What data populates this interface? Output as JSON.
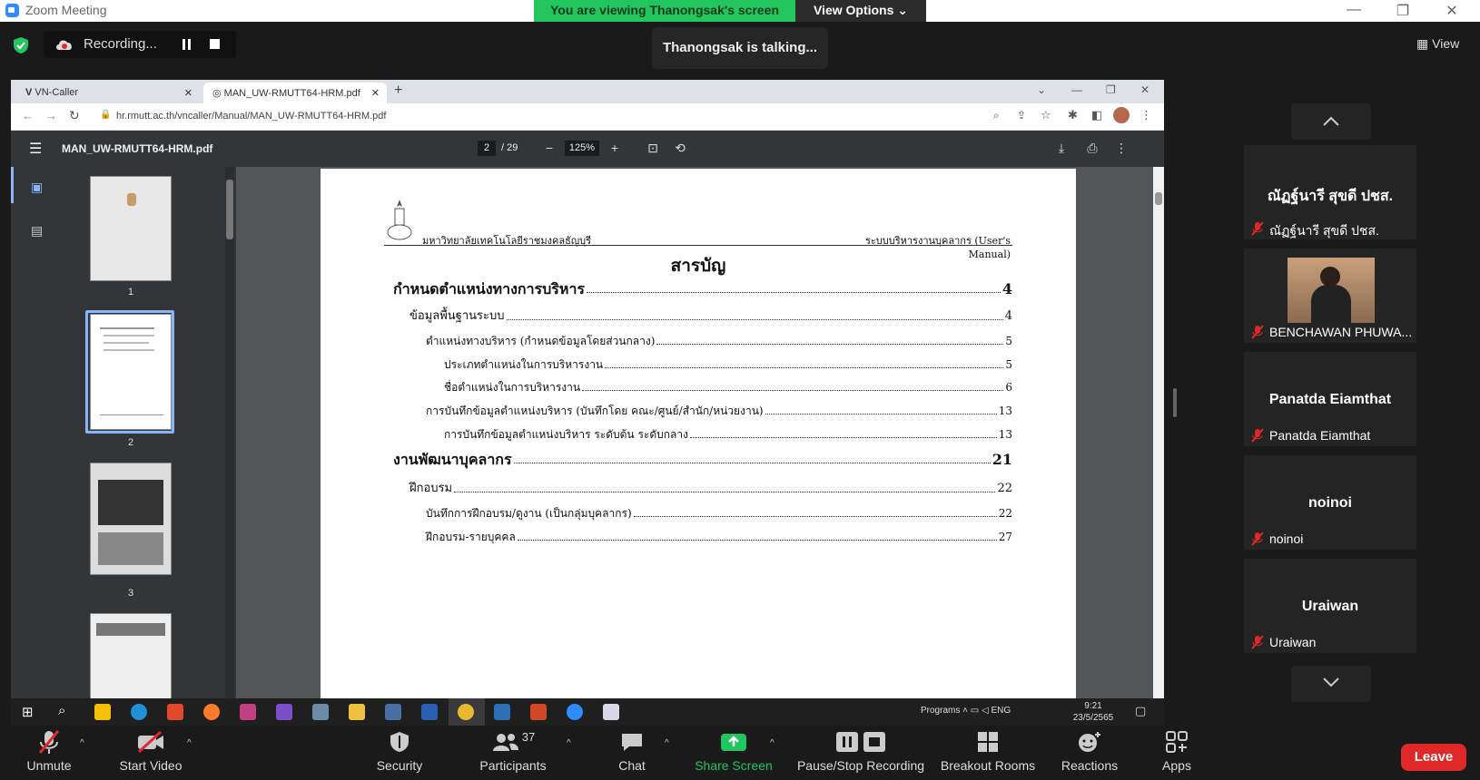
{
  "window": {
    "title": "Zoom Meeting"
  },
  "banner": {
    "viewing": "You are viewing Thanongsak's screen",
    "view_options": "View Options"
  },
  "meeting": {
    "recording": "Recording...",
    "talking": "Thanongsak is talking...",
    "view_label": "View"
  },
  "browser": {
    "tabs": [
      {
        "label": "VN-Caller"
      },
      {
        "label": "MAN_UW-RMUTT64-HRM.pdf"
      }
    ],
    "url": "hr.rmutt.ac.th/vncaller/Manual/MAN_UW-RMUTT64-HRM.pdf"
  },
  "pdf": {
    "filename": "MAN_UW-RMUTT64-HRM.pdf",
    "page_current": "2",
    "page_total": "/ 29",
    "zoom": "125%",
    "thumb_numbers": [
      "1",
      "2",
      "3"
    ],
    "header_left": "มหาวิทยาลัยเทคโนโลยีราชมงคลธัญบุรี",
    "header_right": "ระบบบริหารงานบุคลากร (User's Manual)",
    "toc_title": "สารบัญ",
    "toc": [
      {
        "title": "กำหนดตำแหน่งทางการบริหาร",
        "page": "4"
      },
      {
        "title": "ข้อมูลพื้นฐานระบบ",
        "page": "4"
      },
      {
        "title": "ตำแหน่งทางบริหาร (กำหนดข้อมูลโดยส่วนกลาง)",
        "page": "5"
      },
      {
        "title": "ประเภทตำแหน่งในการบริหารงาน",
        "page": "5"
      },
      {
        "title": "ชื่อตำแหน่งในการบริหารงาน",
        "page": "6"
      },
      {
        "title": "การบันทึกข้อมูลตำแหน่งบริหาร (บันทึกโดย คณะ/ศูนย์/สำนัก/หน่วยงาน)",
        "page": "13"
      },
      {
        "title": "การบันทึกข้อมูลตำแหน่งบริหาร ระดับต้น ระดับกลาง",
        "page": "13"
      },
      {
        "title": "งานพัฒนาบุคลากร",
        "page": "21"
      },
      {
        "title": "ฝึกอบรม",
        "page": "22"
      },
      {
        "title": "บันทึกการฝึกอบรม/ดูงาน (เป็นกลุ่มบุคลากร)",
        "page": "22"
      },
      {
        "title": "ฝึกอบรม-รายบุคคล",
        "page": "27"
      }
    ]
  },
  "participants": [
    {
      "display": "ณัฏฐ์นารี สุขดี ปชส.",
      "name": "ณัฏฐ์นารี สุขดี ปชส."
    },
    {
      "display": "",
      "name": "BENCHAWAN PHUWA..."
    },
    {
      "display": "Panatda Eiamthat",
      "name": "Panatda Eiamthat"
    },
    {
      "display": "noinoi",
      "name": "noinoi"
    },
    {
      "display": "Uraiwan",
      "name": "Uraiwan"
    }
  ],
  "taskbar": {
    "programs": "Programs",
    "lang": "ENG",
    "time": "9:21",
    "date": "23/5/2565"
  },
  "toolbar": {
    "unmute": "Unmute",
    "start_video": "Start Video",
    "security": "Security",
    "participants": "Participants",
    "participants_count": "37",
    "chat": "Chat",
    "share_screen": "Share Screen",
    "pause_stop": "Pause/Stop Recording",
    "breakout": "Breakout Rooms",
    "reactions": "Reactions",
    "apps": "Apps",
    "leave": "Leave"
  },
  "colors": {
    "share_green": "#23c55e",
    "leave_red": "#e02828",
    "mic_off_red": "#e02828"
  }
}
